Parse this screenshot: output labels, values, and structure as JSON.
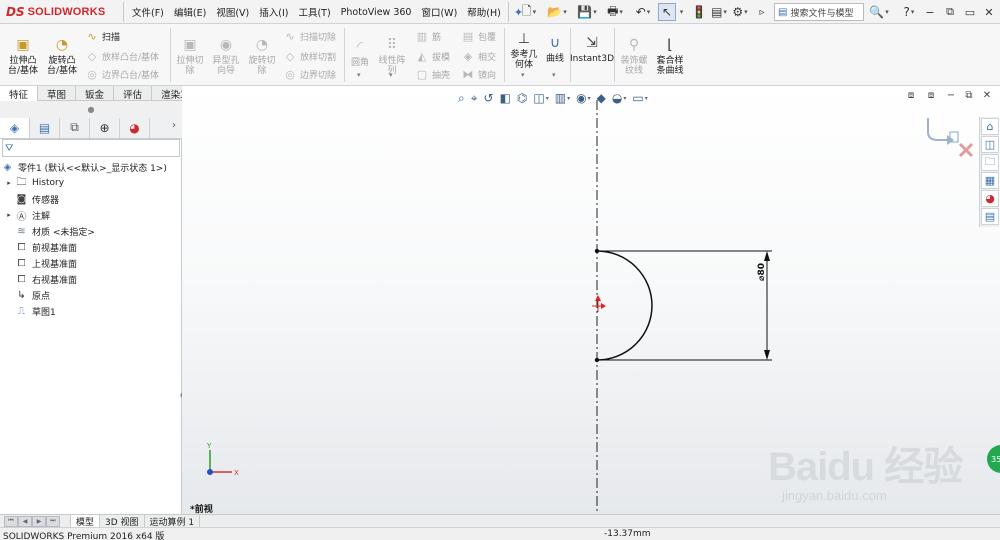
{
  "app": {
    "logo_mark": "DS",
    "logo_text": "SOLIDWORKS"
  },
  "menu": {
    "items": [
      "文件(F)",
      "编辑(E)",
      "视图(V)",
      "插入(I)",
      "工具(T)",
      "PhotoView 360",
      "窗口(W)",
      "帮助(H)"
    ]
  },
  "search": {
    "placeholder": "搜索文件与模型"
  },
  "ribbon": {
    "extrude_boss": "拉伸凸\n台/基体",
    "revolve_boss": "旋转凸\n台/基体",
    "sweep": "扫描",
    "loft_boss": "放样凸台/基体",
    "boundary_boss": "边界凸台/基体",
    "extrude_cut": "拉伸切\n除",
    "hole_wizard": "异型孔\n向导",
    "revolve_cut": "旋转切\n除",
    "swept_cut": "扫描切除",
    "lofted_cut": "放样切割",
    "boundary_cut": "边界切除",
    "fillet": "圆角",
    "linear_pattern": "线性阵\n列",
    "rib": "筋",
    "draft": "拔模",
    "shell": "抽壳",
    "wrap": "包覆",
    "intersect": "相交",
    "mirror": "镜向",
    "reference_geometry": "参考几\n何体",
    "curves": "曲线",
    "instant3d": "Instant3D",
    "install_spline_loft": "装饰螺\n纹线",
    "spline_on_surface": "套合样\n条曲线"
  },
  "command_tabs": {
    "items": [
      "特征",
      "草图",
      "钣金",
      "评估",
      "渲染工具"
    ],
    "active": "特征"
  },
  "feature_tree": {
    "root": "零件1  (默认<<默认>_显示状态 1>)",
    "items": [
      {
        "label": "History",
        "expandable": true,
        "icon": "history-folder-icon"
      },
      {
        "label": "传感器",
        "expandable": false,
        "icon": "sensors-icon"
      },
      {
        "label": "注解",
        "expandable": true,
        "icon": "annotations-icon"
      },
      {
        "label": "材质 <未指定>",
        "expandable": false,
        "icon": "material-icon"
      },
      {
        "label": "前视基准面",
        "expandable": false,
        "icon": "plane-icon"
      },
      {
        "label": "上视基准面",
        "expandable": false,
        "icon": "plane-icon"
      },
      {
        "label": "右视基准面",
        "expandable": false,
        "icon": "plane-icon"
      },
      {
        "label": "原点",
        "expandable": false,
        "icon": "origin-icon"
      },
      {
        "label": "草图1",
        "expandable": false,
        "icon": "sketch-icon"
      }
    ]
  },
  "graphics": {
    "dimension_label": "⌀80",
    "view_name": "*前视",
    "triad_x": "X",
    "triad_y": "Y"
  },
  "watermark": {
    "title": "Baidu 经验",
    "url": "jingyan.baidu.com"
  },
  "badge": {
    "text": "35"
  },
  "bottom_tabs": {
    "items": [
      "模型",
      "3D 视图",
      "运动算例 1"
    ],
    "active": "模型"
  },
  "status": {
    "product": "SOLIDWORKS Premium 2016 x64 版",
    "coordinate": "-13.37mm"
  },
  "colors": {
    "brand_red": "#d1282e",
    "sketch_line": "#111111",
    "origin_red": "#e02020",
    "icon_blue": "#3a6fb0"
  }
}
